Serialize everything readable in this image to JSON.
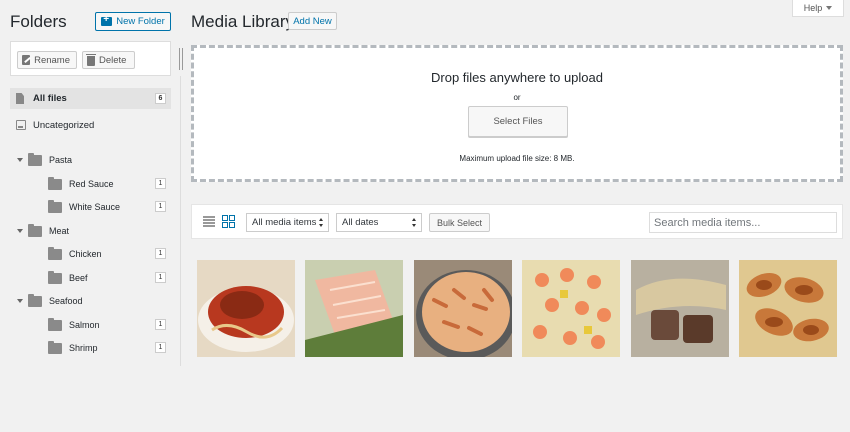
{
  "folders": {
    "title": "Folders",
    "new_folder_label": "New Folder",
    "rename_label": "Rename",
    "delete_label": "Delete",
    "all_files": {
      "label": "All files",
      "count": "6"
    },
    "uncategorized_label": "Uncategorized",
    "tree": [
      {
        "label": "Pasta",
        "children": [
          {
            "label": "Red Sauce",
            "count": "1"
          },
          {
            "label": "White Sauce",
            "count": "1"
          }
        ]
      },
      {
        "label": "Meat",
        "children": [
          {
            "label": "Chicken",
            "count": "1"
          },
          {
            "label": "Beef",
            "count": "1"
          }
        ]
      },
      {
        "label": "Seafood",
        "children": [
          {
            "label": "Salmon",
            "count": "1"
          },
          {
            "label": "Shrimp",
            "count": "1"
          }
        ]
      }
    ]
  },
  "media": {
    "title": "Media Library",
    "add_new_label": "Add New",
    "help_label": "Help",
    "upload": {
      "drop_text": "Drop files anywhere to upload",
      "or_text": "or",
      "select_label": "Select Files",
      "max_size": "Maximum upload file size: 8 MB."
    },
    "toolbar": {
      "type_filter": "All media items",
      "date_filter": "All dates",
      "bulk_label": "Bulk Select",
      "search_placeholder": "Search media items..."
    },
    "thumbnails": [
      {
        "name": "spaghetti-red-sauce",
        "bg": "#e6d9c4",
        "food": "#b8381f",
        "accent": "#8a2a14"
      },
      {
        "name": "salmon-fillet",
        "bg": "#c9cfb0",
        "food": "#f0b8a0",
        "accent": "#5e7d3a"
      },
      {
        "name": "penne-cream-sauce",
        "bg": "#9a8a78",
        "food": "#e8b080",
        "accent": "#c86a3a"
      },
      {
        "name": "shrimp-pasta",
        "bg": "#e8dcb0",
        "food": "#f08a5a",
        "accent": "#e8c83a"
      },
      {
        "name": "steak-bites",
        "bg": "#b8b0a0",
        "food": "#6a4a3a",
        "accent": "#d8c8a0"
      },
      {
        "name": "chicken-wings",
        "bg": "#e0c890",
        "food": "#c8783a",
        "accent": "#9a4a1a"
      }
    ]
  }
}
